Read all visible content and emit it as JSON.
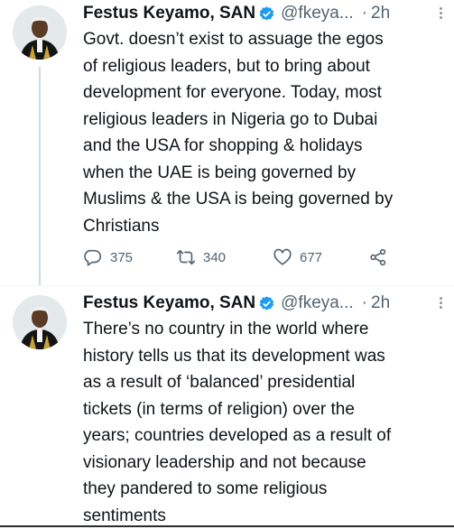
{
  "colors": {
    "verified": "#1d9bf0",
    "secondary_text": "#536471",
    "text": "#0f1419"
  },
  "tweets": [
    {
      "author": "Festus Keyamo, SAN",
      "handle": "@fkeya...",
      "separator": "·",
      "time": "2h",
      "text": "Govt. doesn’t exist to assuage the egos\nof religious leaders, but to bring about\ndevelopment for everyone. Today, most\nreligious leaders in Nigeria go to Dubai\nand the USA for shopping & holidays\nwhen the UAE is being governed by\nMuslims & the USA is being governed by\nChristians",
      "replies": "375",
      "retweets": "340",
      "likes": "677"
    },
    {
      "author": "Festus Keyamo, SAN",
      "handle": "@fkeya...",
      "separator": "·",
      "time": "2h",
      "text": "There’s no country in the world where\nhistory tells us that its development was\nas a result of ‘balanced’ presidential\ntickets (in terms of religion) over the\nyears; countries developed as a result of\nvisionary leadership and not because\nthey pandered to some religious\nsentiments"
    }
  ],
  "icons": {
    "reply": "reply-icon",
    "retweet": "retweet-icon",
    "like": "like-icon",
    "share": "share-icon",
    "verified": "verified-badge-icon",
    "more": "more-options-icon"
  }
}
